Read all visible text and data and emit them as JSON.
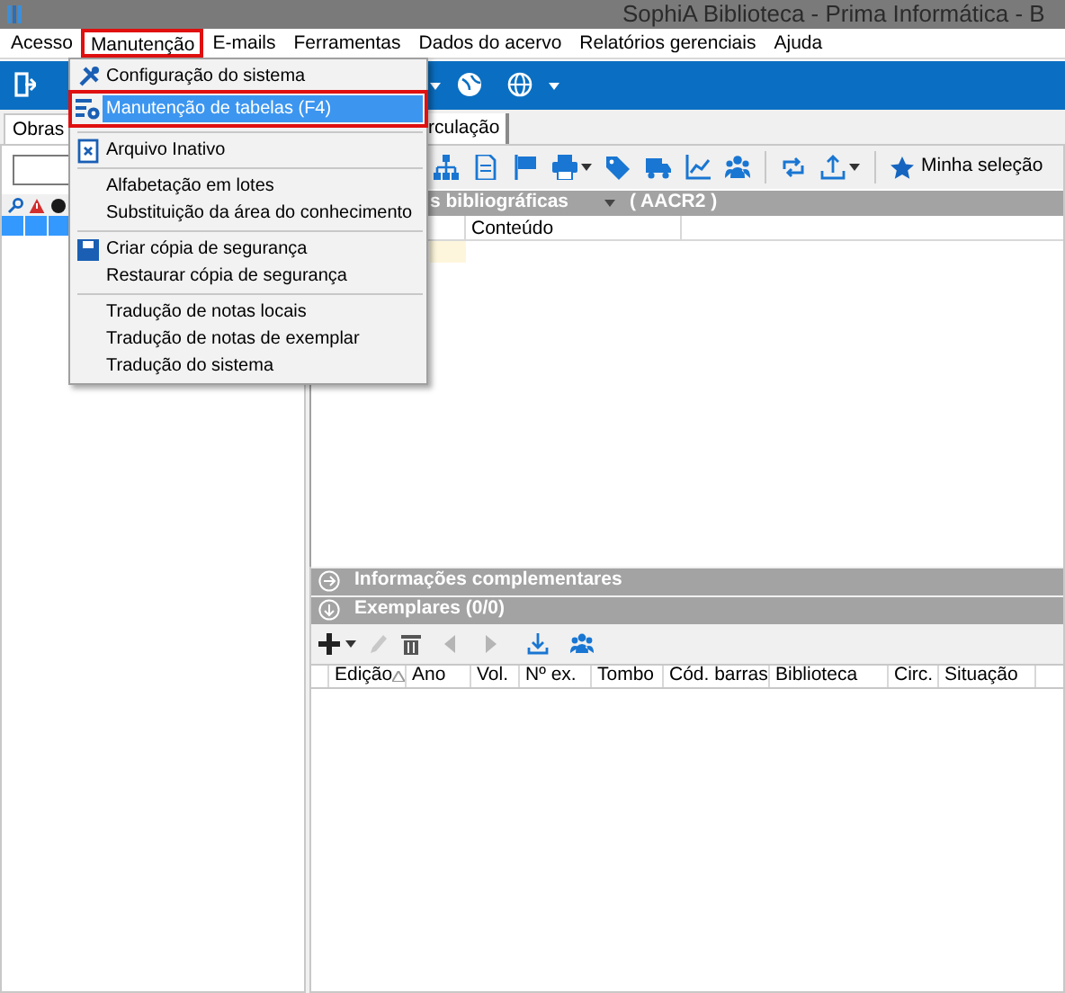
{
  "window": {
    "title": "SophiA Biblioteca - Prima Informática - B"
  },
  "menu_bar": [
    {
      "label": "Acesso",
      "selected": false
    },
    {
      "label": "Manutenção",
      "selected": true
    },
    {
      "label": "E-mails",
      "selected": false
    },
    {
      "label": "Ferramentas",
      "selected": false
    },
    {
      "label": "Dados do acervo",
      "selected": false
    },
    {
      "label": "Relatórios gerenciais",
      "selected": false
    },
    {
      "label": "Ajuda",
      "selected": false
    }
  ],
  "dropdown_menu": [
    {
      "kind": "item",
      "label": "Configuração do sistema",
      "selected": false,
      "highlighted": false
    },
    {
      "kind": "item",
      "label": "Manutenção de tabelas (F4)",
      "selected": true,
      "highlighted": true
    },
    {
      "kind": "separator"
    },
    {
      "kind": "item",
      "label": "Arquivo Inativo",
      "selected": false,
      "highlighted": false
    },
    {
      "kind": "separator"
    },
    {
      "kind": "item",
      "label": "Alfabetação em lotes",
      "selected": false,
      "highlighted": false
    },
    {
      "kind": "item",
      "label": "Substituição da área do conhecimento",
      "selected": false,
      "highlighted": false
    },
    {
      "kind": "separator"
    },
    {
      "kind": "item",
      "label": "Criar cópia de segurança",
      "selected": false,
      "highlighted": false
    },
    {
      "kind": "item",
      "label": "Restaurar cópia de segurança",
      "selected": false,
      "highlighted": false
    },
    {
      "kind": "separator"
    },
    {
      "kind": "item",
      "label": "Tradução de notas locais",
      "selected": false,
      "highlighted": false
    },
    {
      "kind": "item",
      "label": "Tradução de notas de exemplar",
      "selected": false,
      "highlighted": false
    },
    {
      "kind": "item",
      "label": "Tradução do sistema",
      "selected": false,
      "highlighted": false
    }
  ],
  "left_panel": {
    "tab": {
      "label": "Obras",
      "selected": true
    }
  },
  "right_panel": {
    "tab": {
      "label": "rculação",
      "selected": false
    },
    "toolbar": {
      "selection_button": "Minha seleção"
    },
    "details_bar": {
      "label": "s bibliográficas",
      "standard": "( AACR2 )"
    },
    "grid_columns": [
      "Conteúdo"
    ],
    "sections": [
      {
        "label": "Informações complementares",
        "expanded": false
      },
      {
        "label": "Exemplares (0/0)",
        "expanded": true
      }
    ],
    "exemplares_columns": [
      {
        "label": "Edição",
        "sorted": true
      },
      {
        "label": "Ano",
        "sorted": false
      },
      {
        "label": "Vol.",
        "sorted": false
      },
      {
        "label": "Nº ex.",
        "sorted": false
      },
      {
        "label": "Tombo",
        "sorted": false
      },
      {
        "label": "Cód. barras",
        "sorted": false
      },
      {
        "label": "Biblioteca",
        "sorted": false
      },
      {
        "label": "Circ.",
        "sorted": false
      },
      {
        "label": "Situação",
        "sorted": false
      }
    ]
  }
}
